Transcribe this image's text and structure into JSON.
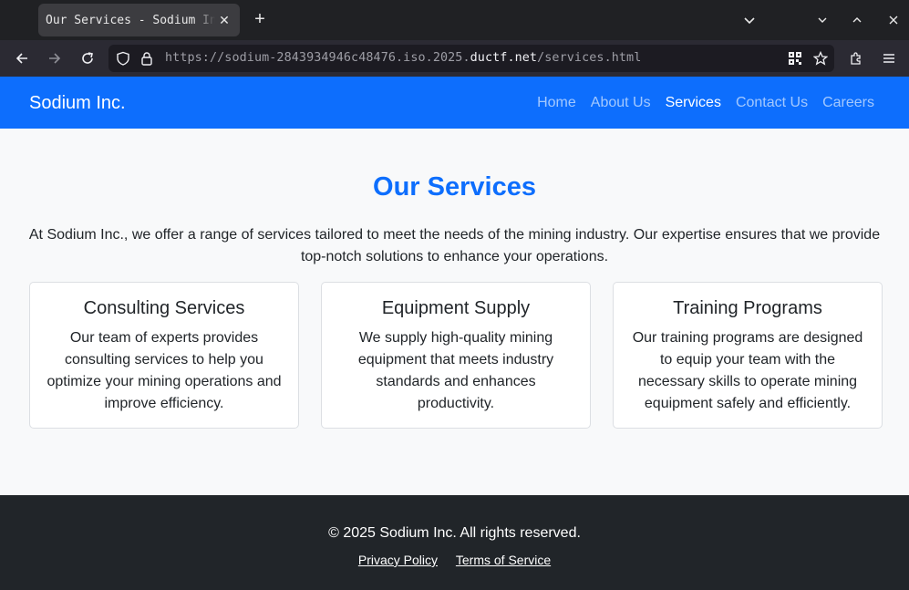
{
  "browser": {
    "tab_title": "Our Services - Sodium Inc.",
    "url_prefix": "https://sodium-2843934946c48476.iso.2025.",
    "url_domain": "ductf.net",
    "url_path": "/services.html"
  },
  "header": {
    "brand": "Sodium Inc.",
    "nav": [
      "Home",
      "About Us",
      "Services",
      "Contact Us",
      "Careers"
    ],
    "active": "Services"
  },
  "main": {
    "title": "Our Services",
    "intro": "At Sodium Inc., we offer a range of services tailored to meet the needs of the mining industry. Our expertise ensures that we provide top-notch solutions to enhance your operations.",
    "cards": [
      {
        "title": "Consulting Services",
        "text": "Our team of experts provides consulting services to help you optimize your mining operations and improve efficiency."
      },
      {
        "title": "Equipment Supply",
        "text": "We supply high-quality mining equipment that meets industry standards and enhances productivity."
      },
      {
        "title": "Training Programs",
        "text": "Our training programs are designed to equip your team with the necessary skills to operate mining equipment safely and efficiently."
      }
    ]
  },
  "footer": {
    "copyright": "© 2025 Sodium Inc. All rights reserved.",
    "links": [
      "Privacy Policy",
      "Terms of Service"
    ]
  },
  "colors": {
    "primary": "#0d6efd",
    "footer_bg": "#212529",
    "page_bg": "#f8f9fa"
  }
}
